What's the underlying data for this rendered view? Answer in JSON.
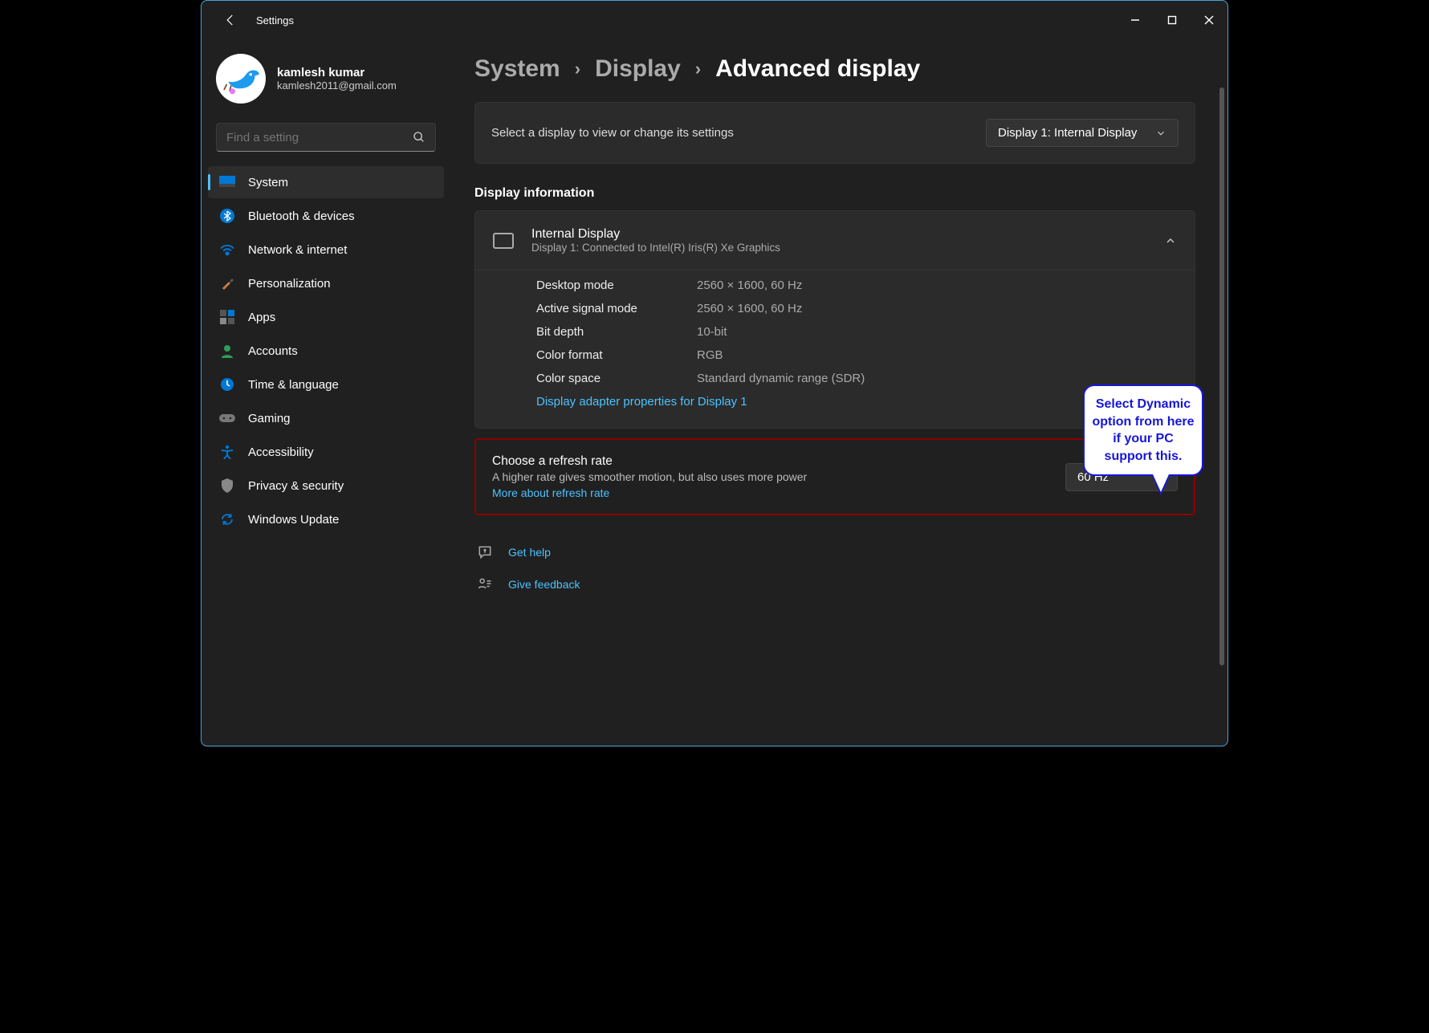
{
  "titlebar": {
    "app_title": "Settings"
  },
  "user": {
    "name": "kamlesh kumar",
    "email": "kamlesh2011@gmail.com"
  },
  "search": {
    "placeholder": "Find a setting"
  },
  "nav": {
    "items": [
      {
        "label": "System"
      },
      {
        "label": "Bluetooth & devices"
      },
      {
        "label": "Network & internet"
      },
      {
        "label": "Personalization"
      },
      {
        "label": "Apps"
      },
      {
        "label": "Accounts"
      },
      {
        "label": "Time & language"
      },
      {
        "label": "Gaming"
      },
      {
        "label": "Accessibility"
      },
      {
        "label": "Privacy & security"
      },
      {
        "label": "Windows Update"
      }
    ]
  },
  "breadcrumb": {
    "a": "System",
    "b": "Display",
    "c": "Advanced display"
  },
  "display_select": {
    "label": "Select a display to view or change its settings",
    "selected": "Display 1: Internal Display"
  },
  "section_title": "Display information",
  "display_info": {
    "name": "Internal Display",
    "sub": "Display 1: Connected to Intel(R) Iris(R) Xe Graphics",
    "rows": [
      {
        "k": "Desktop mode",
        "v": "2560 × 1600, 60 Hz"
      },
      {
        "k": "Active signal mode",
        "v": "2560 × 1600, 60 Hz"
      },
      {
        "k": "Bit depth",
        "v": "10-bit"
      },
      {
        "k": "Color format",
        "v": "RGB"
      },
      {
        "k": "Color space",
        "v": "Standard dynamic range (SDR)"
      }
    ],
    "adapter_link": "Display adapter properties for Display 1"
  },
  "refresh": {
    "title": "Choose a refresh rate",
    "sub": "A higher rate gives smoother motion, but also uses more power",
    "more": "More about refresh rate",
    "selected": "60 Hz"
  },
  "help": {
    "get_help": "Get help",
    "give_feedback": "Give feedback"
  },
  "callout": "Select Dynamic option from here if your PC support this."
}
